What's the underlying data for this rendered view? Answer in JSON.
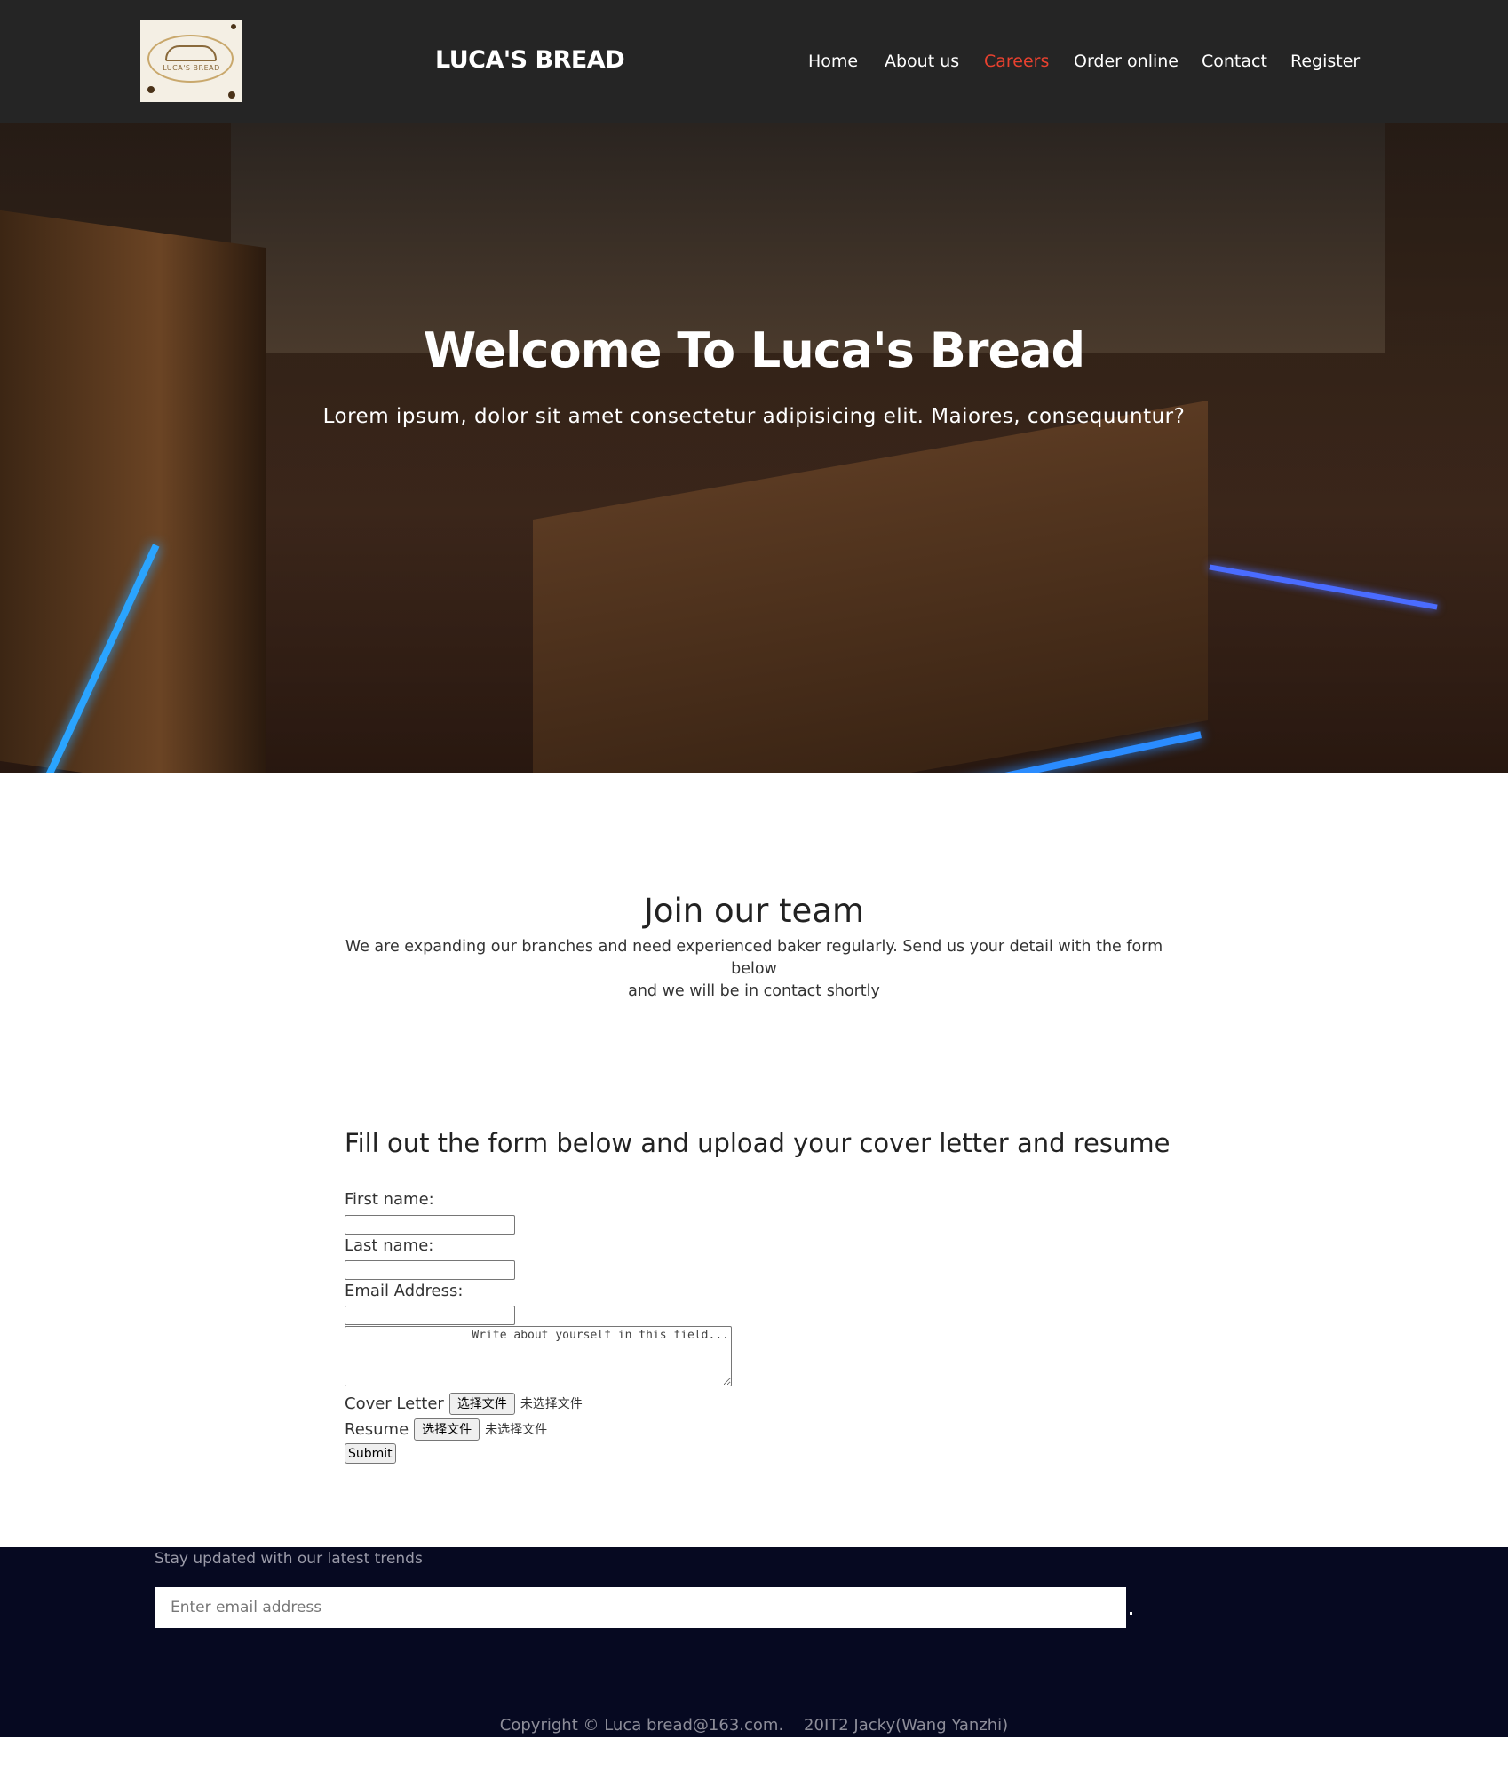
{
  "header": {
    "logo_text": "LUCA'S BREAD",
    "brand": "LUCA'S BREAD",
    "nav": [
      {
        "label": "Home",
        "active": false
      },
      {
        "label": "About us",
        "active": false
      },
      {
        "label": "Careers",
        "active": true
      },
      {
        "label": "Order online",
        "active": false
      },
      {
        "label": "Contact",
        "active": false
      },
      {
        "label": "Register",
        "active": false
      }
    ],
    "active_color": "#e8412f",
    "background": "#252525"
  },
  "hero": {
    "title": "Welcome To Luca's Bread",
    "subtitle": "Lorem ipsum, dolor sit amet consectetur adipisicing elit. Maiores, consequuntur?"
  },
  "join": {
    "title": "Join our team",
    "text_line1": "We are expanding our branches and need experienced baker regularly. Send us your detail with the form below",
    "text_line2": "and we will be in contact shortly"
  },
  "form": {
    "title": "Fill out the form below and upload your cover letter and resume",
    "first_name_label": "First name:",
    "first_name_value": "",
    "last_name_label": "Last name:",
    "last_name_value": "",
    "email_label": "Email Address:",
    "email_value": "",
    "about_placeholder": "Write about yourself in this field...",
    "cover_letter_label": "Cover Letter",
    "resume_label": "Resume",
    "file_button_label": "选择文件",
    "file_status": "未选择文件",
    "submit_label": "Submit"
  },
  "footer": {
    "tagline": "Stay updated with our latest trends",
    "email_placeholder": "Enter email address",
    "copyright": "Copyright © Luca bread@163.com.    20IT2 Jacky(Wang Yanzhi)",
    "background": "#060921"
  }
}
